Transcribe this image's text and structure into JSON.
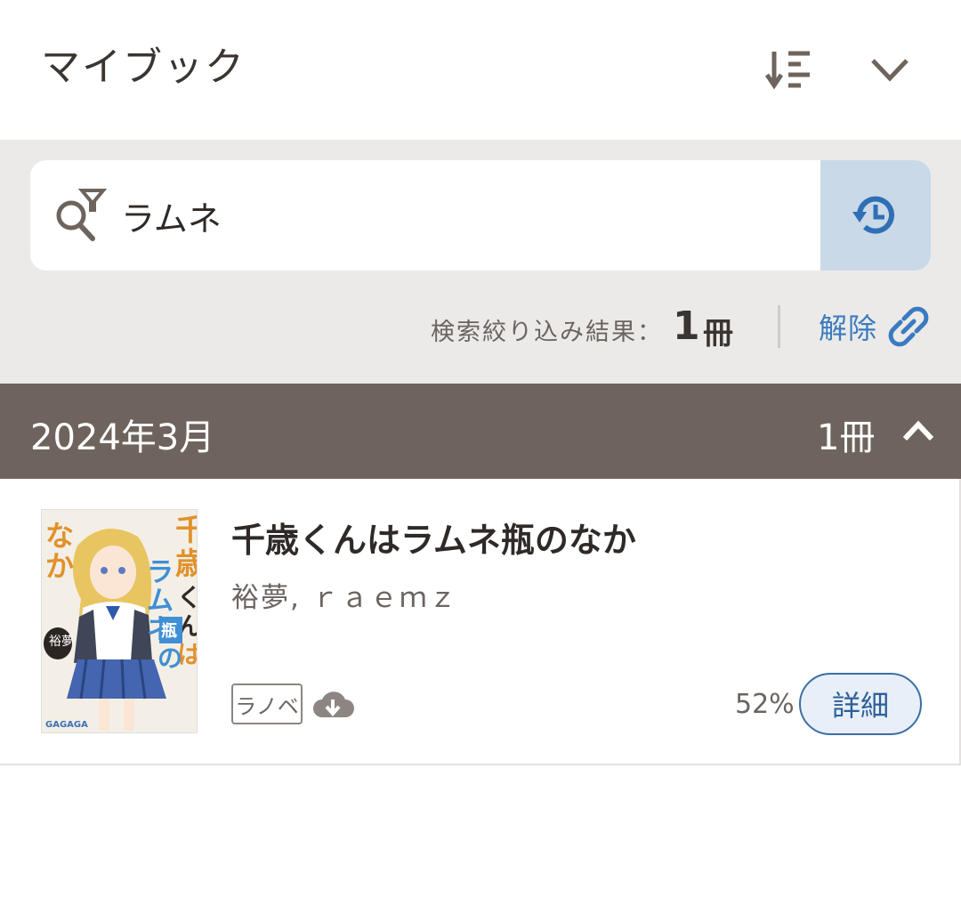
{
  "header": {
    "title": "マイブック",
    "sort_icon": "sort-icon",
    "select_icon": "check-icon"
  },
  "search": {
    "query": "ラムネ",
    "filter_icon": "search-filter-icon",
    "history_icon": "history-icon"
  },
  "results": {
    "label": "検索絞り込み結果：",
    "count": "1",
    "unit": "冊",
    "clear_label": "解除",
    "clear_icon": "unlink-icon"
  },
  "section": {
    "month": "2024年3月",
    "count": "1冊",
    "toggle_icon": "chevron-up-icon"
  },
  "book": {
    "title": "千歳くんはラムネ瓶のなか",
    "author": "裕夢, ｒａｅｍｚ",
    "tag": "ラノベ",
    "download_icon": "cloud-download-icon",
    "progress": "52%",
    "detail_label": "詳細",
    "cover": {
      "title_text": "千歳くんはラムネ瓶のなか",
      "author_text": "裕夢",
      "publisher_text": "GAGAGA"
    }
  },
  "colors": {
    "brand_brown": "#6e645d",
    "accent_blue": "#3a7bc0",
    "history_bg": "#c9d9e8",
    "band_bg": "#eceae8"
  }
}
